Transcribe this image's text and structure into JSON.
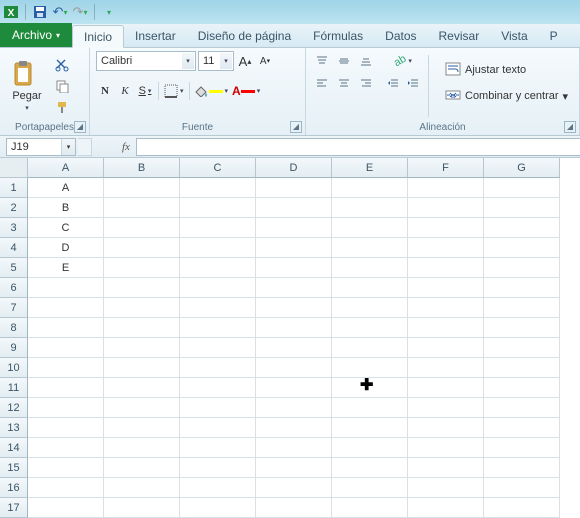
{
  "qat": {
    "save": "💾",
    "undo": "↶",
    "redo": "↷"
  },
  "tabs": {
    "file": "Archivo",
    "items": [
      "Inicio",
      "Insertar",
      "Diseño de página",
      "Fórmulas",
      "Datos",
      "Revisar",
      "Vista",
      "P"
    ]
  },
  "ribbon": {
    "clipboard": {
      "paste": "Pegar",
      "label": "Portapapeles"
    },
    "font": {
      "name": "Calibri",
      "size": "11",
      "bold": "N",
      "italic": "K",
      "underline": "S",
      "label": "Fuente",
      "grow": "A",
      "shrink": "A",
      "fill_color": "#ffff00",
      "font_color": "#ff0000"
    },
    "align": {
      "wrap": "Ajustar texto",
      "merge": "Combinar y centrar",
      "label": "Alineación"
    }
  },
  "namebox": "J19",
  "fx": "fx",
  "columns": [
    "A",
    "B",
    "C",
    "D",
    "E",
    "F",
    "G"
  ],
  "rows": [
    "1",
    "2",
    "3",
    "4",
    "5",
    "6",
    "7",
    "8",
    "9",
    "10",
    "11",
    "12",
    "13",
    "14",
    "15",
    "16",
    "17"
  ],
  "cells": {
    "A1": "A",
    "A2": "B",
    "A3": "C",
    "A4": "D",
    "A5": "E"
  }
}
